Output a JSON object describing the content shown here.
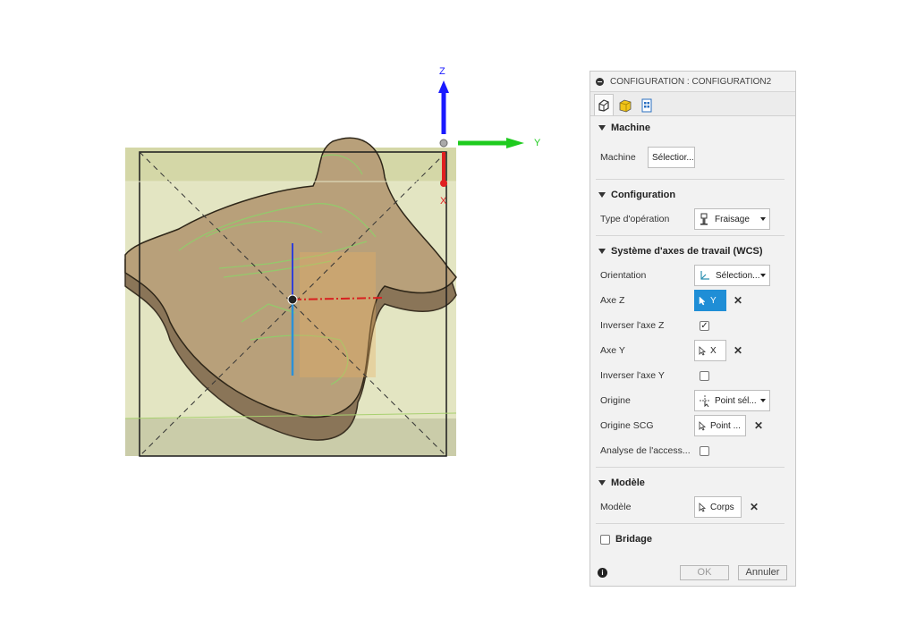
{
  "viewport": {
    "axis_labels": {
      "z": "Z",
      "y": "Y",
      "x": "X"
    },
    "colors": {
      "z_axis": "#1a1aff",
      "y_axis": "#1ecb1e",
      "x_axis": "#e02020",
      "stock": "#cfd4a0",
      "wood": "#b8a07a"
    }
  },
  "panel": {
    "title": "CONFIGURATION : CONFIGURATION2",
    "tabs": [
      {
        "icon": "setup-tab-icon"
      },
      {
        "icon": "stock-tab-icon"
      },
      {
        "icon": "post-process-tab-icon"
      }
    ],
    "sections": {
      "machine": {
        "title": "Machine",
        "machine_label": "Machine",
        "machine_button": "Sélectior..."
      },
      "configuration": {
        "title": "Configuration",
        "operation_type_label": "Type d'opération",
        "operation_type_value": "Fraisage"
      },
      "wcs": {
        "title": "Système d'axes de travail (WCS)",
        "orientation_label": "Orientation",
        "orientation_value": "Sélection...",
        "axis_z_label": "Axe Z",
        "axis_z_value": "Y",
        "invert_z_label": "Inverser l'axe Z",
        "invert_z_checked": true,
        "axis_y_label": "Axe Y",
        "axis_y_value": "X",
        "invert_y_label": "Inverser l'axe Y",
        "invert_y_checked": false,
        "origin_label": "Origine",
        "origin_value": "Point sél...",
        "origin_scg_label": "Origine SCG",
        "origin_scg_value": "Point ...",
        "access_label": "Analyse de l'access...",
        "access_checked": false
      },
      "model": {
        "title": "Modèle",
        "model_label": "Modèle",
        "model_value": "Corps"
      },
      "clamping": {
        "title": "Bridage",
        "checked": false
      }
    },
    "footer": {
      "ok_label": "OK",
      "cancel_label": "Annuler"
    }
  }
}
